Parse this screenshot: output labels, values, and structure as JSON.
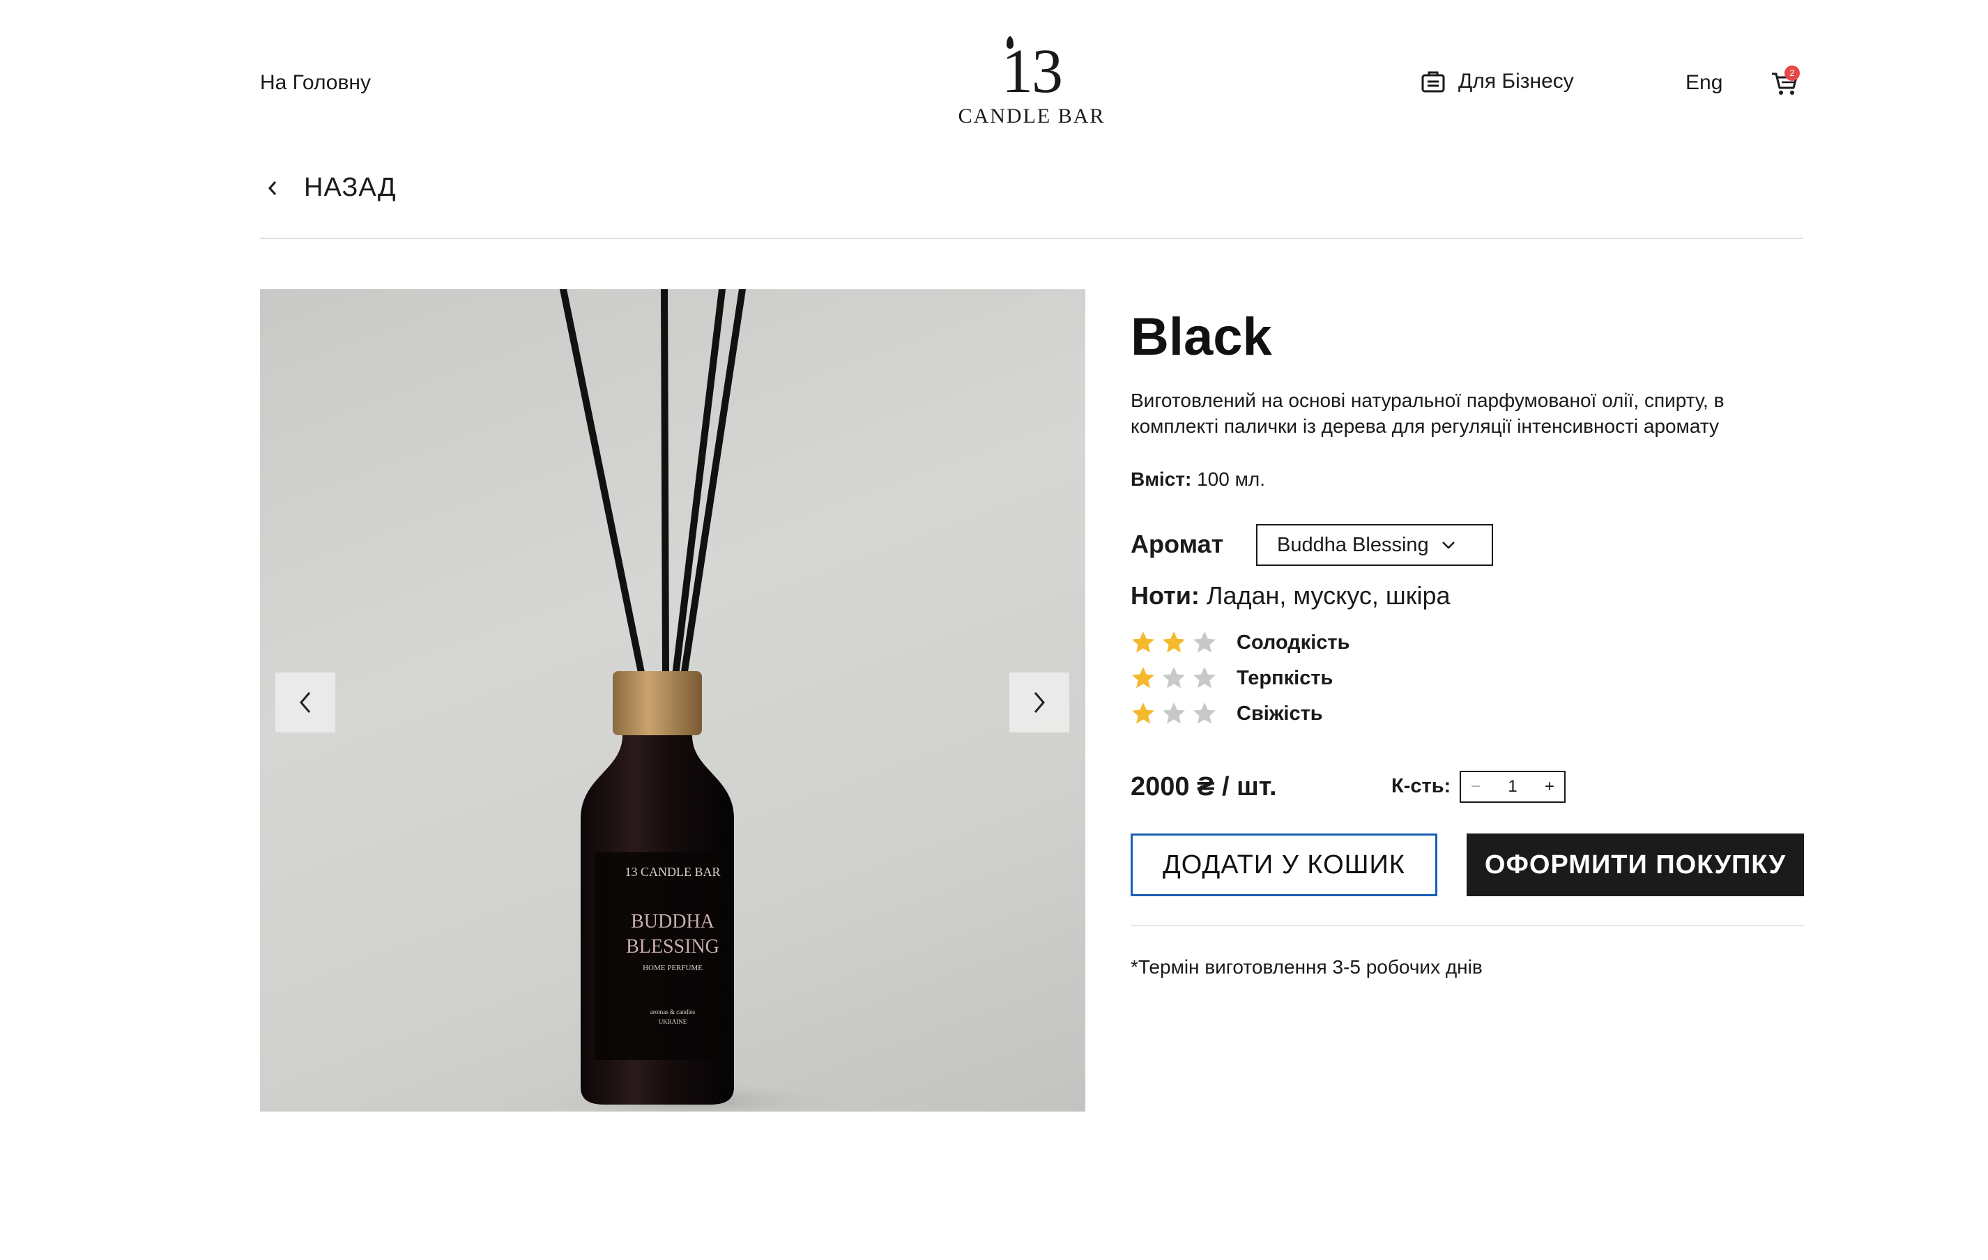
{
  "header": {
    "home_link": "На Головну",
    "logo_number": "13",
    "logo_text": "CANDLE  BAR",
    "business_link": "Для Бізнесу",
    "language": "Eng",
    "cart_count": "2"
  },
  "back": {
    "label": "НАЗАД"
  },
  "gallery": {
    "bottle_brand": "13 CANDLE BAR",
    "bottle_name_line1": "BUDDHA",
    "bottle_name_line2": "BLESSING",
    "bottle_type": "HOME PERFUME",
    "bottle_sub1": "aromas & candles",
    "bottle_sub2": "UKRAINE"
  },
  "product": {
    "title": "Black",
    "description": "Виготовлений на основі натуральної парфумованої олії, спирту, в комплекті палички із дерева для регуляції інтенсивності аромату",
    "volume_label": "Вміст:",
    "volume_value": " 100 мл.",
    "aroma_label": "Аромат",
    "aroma_selected": "Buddha Blessing",
    "notes_label": "Ноти:",
    "notes_value": " Ладан, мускус, шкіра",
    "ratings": [
      {
        "label": "Солодкість",
        "value": 2,
        "max": 3
      },
      {
        "label": "Терпкість",
        "value": 1,
        "max": 3
      },
      {
        "label": "Свіжість",
        "value": 1,
        "max": 3
      }
    ],
    "price": "2000 ₴ / шт.",
    "quantity_label": "К-сть:",
    "quantity_value": "1",
    "add_to_cart": "ДОДАТИ У КОШИК",
    "checkout": "ОФОРМИТИ ПОКУПКУ",
    "production_note": "*Термін виготовлення 3-5 робочих днів"
  },
  "colors": {
    "star_filled": "#f5b92e",
    "star_empty": "#c8c8c8",
    "add_button_border": "#1a5fb4",
    "buy_button_bg": "#1b1b1b",
    "cart_badge": "#e54848"
  }
}
